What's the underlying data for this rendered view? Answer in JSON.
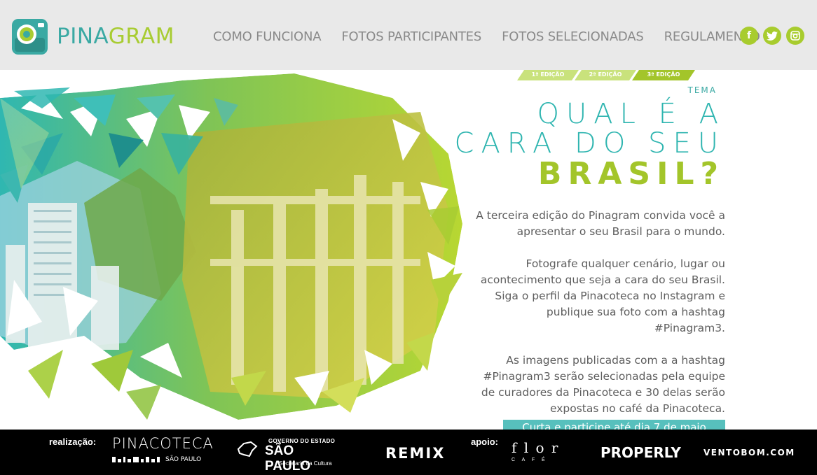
{
  "colors": {
    "accent_teal": "#3aa9a3",
    "accent_green": "#a8cc32",
    "header_bg": "#e9e9e9",
    "nav_text": "#8a8a8a",
    "body_text": "#5e5e5e",
    "cta_bg": "#57c0bd",
    "footer_bg": "#000000"
  },
  "brand": {
    "part1": "PINA",
    "part2": "GRAM"
  },
  "nav": [
    {
      "label": "COMO FUNCIONA"
    },
    {
      "label": "FOTOS PARTICIPANTES"
    },
    {
      "label": "FOTOS SELECIONADAS"
    },
    {
      "label": "REGULAMENTO"
    }
  ],
  "social": [
    {
      "icon": "facebook-icon",
      "glyph": "f"
    },
    {
      "icon": "twitter-icon",
      "glyph": "t"
    },
    {
      "icon": "instagram-icon",
      "glyph": "◎"
    }
  ],
  "editions": [
    {
      "label": "1ª EDIÇÃO",
      "active": false
    },
    {
      "label": "2ª EDIÇÃO",
      "active": false
    },
    {
      "label": "3ª EDIÇÃO",
      "active": true
    }
  ],
  "hero": {
    "tema": "TEMA",
    "line1": "QUAL É A",
    "line2": "CARA DO SEU",
    "line3": "BRASIL?",
    "paragraphs": [
      "A terceira edição do Pinagram convida você a apresentar o seu Brasil para o mundo.",
      "Fotografe qualquer cenário, lugar ou acontecimento que seja a cara do seu Brasil. Siga o perfil da Pinacoteca no Instagram e publique sua foto com a hashtag #Pinagram3.",
      "As imagens publicadas com a a hashtag #Pinagram3 serão selecionadas pela equipe de curadores da Pinacoteca e 30 delas serão expostas no café da Pinacoteca."
    ],
    "cta": "Curta e participe até dia 7 de maio"
  },
  "footer": {
    "realizacao_label": "realização:",
    "apoio_label": "apoio:",
    "pinacoteca": {
      "name": "PINACOTECA",
      "sub": "SÃO PAULO"
    },
    "governo": {
      "line1": "GOVERNO DO ESTADO",
      "line2": "SÃO PAULO",
      "line3": "Secretaria da Cultura"
    },
    "remix": "REMIX",
    "flor": {
      "name": "f l o r",
      "sub": "C A F É"
    },
    "properly": "PROPERLY",
    "ventobom": "VENTOBOM.COM"
  }
}
